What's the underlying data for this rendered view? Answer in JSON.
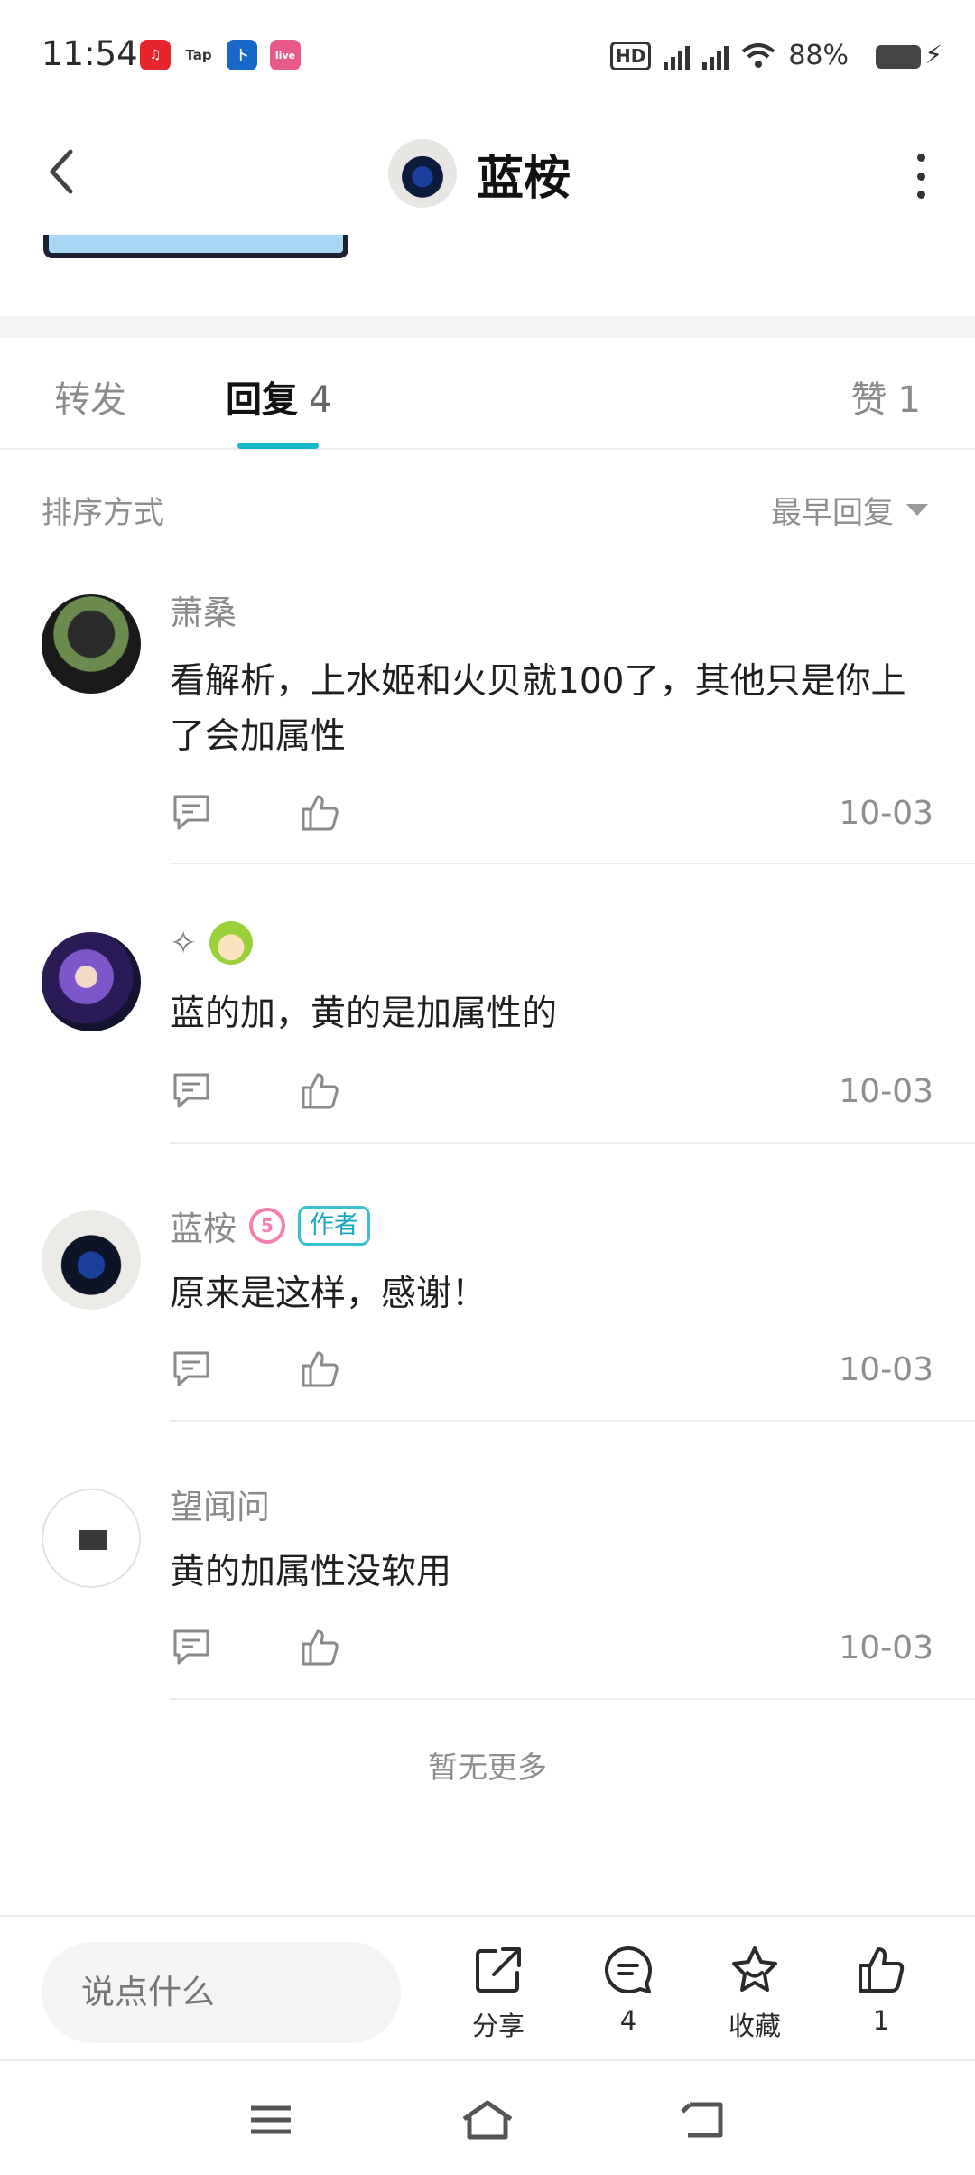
{
  "status_bar": {
    "time": "11:54",
    "apps": [
      "netease-music",
      "taptap",
      "bank",
      "weibo-live"
    ],
    "indicators": [
      "HD2",
      "5G",
      "5G",
      "wifi"
    ],
    "battery": "88%"
  },
  "header": {
    "title": "蓝桉"
  },
  "tabs": {
    "forward_label": "转发",
    "reply_label": "回复",
    "reply_count": "4",
    "like_label": "赞",
    "like_count": "1"
  },
  "sort": {
    "label": "排序方式",
    "selected": "最早回复"
  },
  "comments": [
    {
      "user": "萧桑",
      "text": "看解析，上水姬和火贝就100了，其他只是你上了会加属性",
      "date": "10-03"
    },
    {
      "user": "✧",
      "text": "蓝的加，黄的是加属性的",
      "date": "10-03"
    },
    {
      "user": "蓝桉",
      "level": "5",
      "badge": "作者",
      "text": "原来是这样，感谢！",
      "date": "10-03"
    },
    {
      "user": "望闻问",
      "text": "黄的加属性没软用",
      "date": "10-03"
    }
  ],
  "footer_note": "暂无更多",
  "bottom_bar": {
    "input_placeholder": "说点什么",
    "share_label": "分享",
    "comment_count": "4",
    "favorite_label": "收藏",
    "like_count": "1"
  },
  "colors": {
    "accent": "#15b8c8",
    "author_badge": "#39c1cf",
    "level_badge": "#f27fb0"
  }
}
